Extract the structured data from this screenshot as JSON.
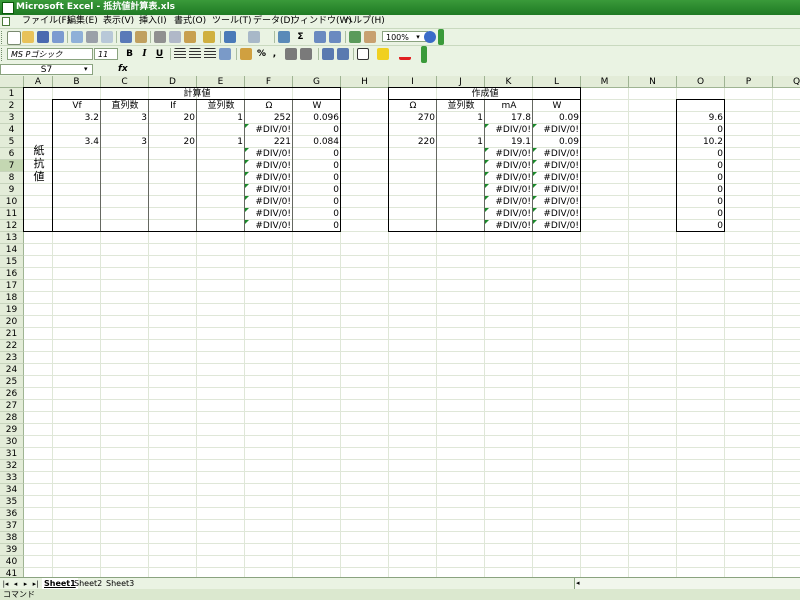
{
  "window": {
    "title": "Microsoft Excel - 抵抗値計算表.xls"
  },
  "menu": [
    "ファイル(F)",
    "編集(E)",
    "表示(V)",
    "挿入(I)",
    "書式(O)",
    "ツール(T)",
    "データ(D)",
    "ウィンドウ(W)",
    "ヘルプ(H)"
  ],
  "toolbar": {
    "zoom": "100%",
    "font_name": "MS Pゴシック",
    "font_size": "11",
    "bold_label": "B",
    "italic_label": "I",
    "underline_label": "U",
    "percent_label": "%",
    "comma_label": ",",
    "sigma_label": "Σ"
  },
  "formula_bar": {
    "name_box": "S7",
    "fx_label": "fx",
    "content": ""
  },
  "columns": [
    "A",
    "B",
    "C",
    "D",
    "E",
    "F",
    "G",
    "H",
    "I",
    "J",
    "K",
    "L",
    "M",
    "N",
    "O",
    "P",
    "Q"
  ],
  "rows": [
    "1",
    "2",
    "3",
    "4",
    "5",
    "6",
    "7",
    "8",
    "9",
    "10",
    "11",
    "12",
    "13",
    "14",
    "15",
    "16",
    "17",
    "18",
    "19",
    "20",
    "21",
    "22",
    "23",
    "24",
    "25",
    "26",
    "27",
    "28",
    "29",
    "30",
    "31",
    "32",
    "33",
    "34",
    "35",
    "36",
    "37",
    "38",
    "39",
    "40",
    "41"
  ],
  "selected_row": "7",
  "sheet": {
    "left_title": "計算値",
    "right_title": "作成値",
    "side_label": [
      "紙",
      "抗",
      "値"
    ],
    "left_headers": [
      "Vf",
      "直列数",
      "If",
      "並列数",
      "Ω",
      "W"
    ],
    "right_headers": [
      "Ω",
      "並列数",
      "mA",
      "W"
    ],
    "left_rows": [
      [
        "3.2",
        "3",
        "20",
        "1",
        "252",
        "0.096"
      ],
      [
        "",
        "",
        "",
        "",
        "#DIV/0!",
        "0"
      ],
      [
        "3.4",
        "3",
        "20",
        "1",
        "221",
        "0.084"
      ],
      [
        "",
        "",
        "",
        "",
        "#DIV/0!",
        "0"
      ],
      [
        "",
        "",
        "",
        "",
        "#DIV/0!",
        "0"
      ],
      [
        "",
        "",
        "",
        "",
        "#DIV/0!",
        "0"
      ],
      [
        "",
        "",
        "",
        "",
        "#DIV/0!",
        "0"
      ],
      [
        "",
        "",
        "",
        "",
        "#DIV/0!",
        "0"
      ],
      [
        "",
        "",
        "",
        "",
        "#DIV/0!",
        "0"
      ],
      [
        "",
        "",
        "",
        "",
        "#DIV/0!",
        "0"
      ]
    ],
    "right_rows": [
      [
        "270",
        "1",
        "17.8",
        "0.09"
      ],
      [
        "",
        "",
        "#DIV/0!",
        "#DIV/0!"
      ],
      [
        "220",
        "1",
        "19.1",
        "0.09"
      ],
      [
        "",
        "",
        "#DIV/0!",
        "#DIV/0!"
      ],
      [
        "",
        "",
        "#DIV/0!",
        "#DIV/0!"
      ],
      [
        "",
        "",
        "#DIV/0!",
        "#DIV/0!"
      ],
      [
        "",
        "",
        "#DIV/0!",
        "#DIV/0!"
      ],
      [
        "",
        "",
        "#DIV/0!",
        "#DIV/0!"
      ],
      [
        "",
        "",
        "#DIV/0!",
        "#DIV/0!"
      ],
      [
        "",
        "",
        "#DIV/0!",
        "#DIV/0!"
      ]
    ],
    "o_values": [
      "9.6",
      "0",
      "10.2",
      "0",
      "0",
      "0",
      "0",
      "0",
      "0",
      "0"
    ]
  },
  "tabs": [
    "Sheet1",
    "Sheet2",
    "Sheet3"
  ],
  "active_tab": "Sheet1",
  "status": "コマンド",
  "colors": {
    "title_bar": "#1f7a24",
    "chrome": "#eaf3e3",
    "header": "#e3ecd8",
    "error_marker": "#1a8a2a"
  }
}
